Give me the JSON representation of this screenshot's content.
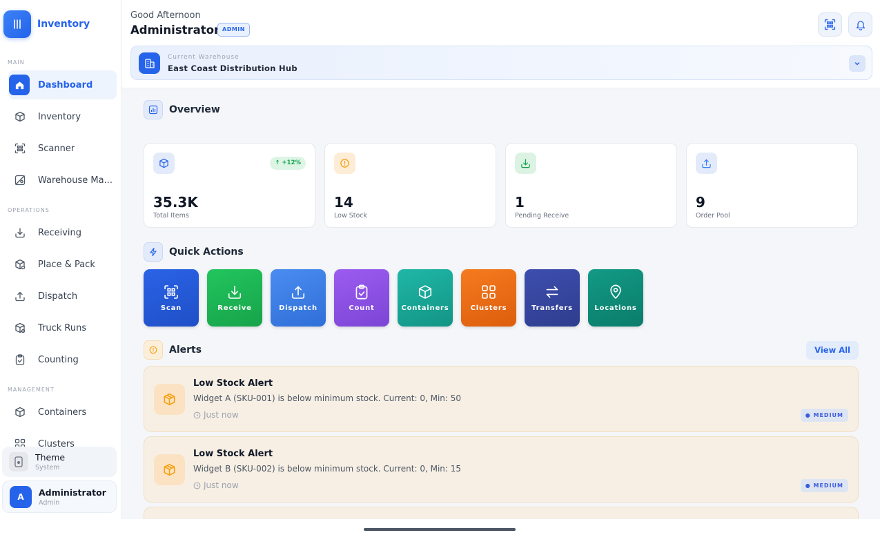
{
  "sidebar": {
    "brand": "Inventory",
    "sections": {
      "main": "MAIN",
      "operations": "OPERATIONS",
      "management": "MANAGEMENT"
    },
    "items": [
      {
        "label": "Dashboard",
        "icon": "home-icon"
      },
      {
        "label": "Inventory",
        "icon": "box-icon"
      },
      {
        "label": "Scanner",
        "icon": "scan-icon"
      },
      {
        "label": "Warehouse Ma...",
        "icon": "map-icon"
      },
      {
        "label": "Receiving",
        "icon": "download-icon"
      },
      {
        "label": "Place & Pack",
        "icon": "package-icon"
      },
      {
        "label": "Dispatch",
        "icon": "upload-icon"
      },
      {
        "label": "Truck Runs",
        "icon": "truck-box-icon"
      },
      {
        "label": "Counting",
        "icon": "clipboard-icon"
      },
      {
        "label": "Containers",
        "icon": "container-icon"
      },
      {
        "label": "Clusters",
        "icon": "grid-icon"
      }
    ],
    "theme": {
      "title": "Theme",
      "sub": "System"
    },
    "user": {
      "initial": "A",
      "name": "Administrator",
      "role": "Admin"
    }
  },
  "header": {
    "greeting": "Good Afternoon",
    "name": "Administrator",
    "badge": "ADMIN",
    "warehouse_label": "Current Warehouse",
    "warehouse_value": "East Coast Distribution Hub"
  },
  "overview": {
    "title": "Overview",
    "stats": [
      {
        "value": "35.3K",
        "label": "Total Items",
        "trend": "+12%"
      },
      {
        "value": "14",
        "label": "Low Stock"
      },
      {
        "value": "1",
        "label": "Pending Receive"
      },
      {
        "value": "9",
        "label": "Order Pool"
      }
    ]
  },
  "quick_actions": {
    "title": "Quick Actions",
    "items": [
      "Scan",
      "Receive",
      "Dispatch",
      "Count",
      "Containers",
      "Clusters",
      "Transfers",
      "Locations"
    ]
  },
  "alerts": {
    "title": "Alerts",
    "view_all": "View All",
    "items": [
      {
        "title": "Low Stock Alert",
        "message": "Widget A (SKU-001) is below minimum stock. Current: 0, Min: 50",
        "time": "Just now",
        "severity": "MEDIUM"
      },
      {
        "title": "Low Stock Alert",
        "message": "Widget B (SKU-002) is below minimum stock. Current: 0, Min: 15",
        "time": "Just now",
        "severity": "MEDIUM"
      }
    ]
  },
  "colors": {
    "accent": "#2563eb",
    "qa_scan": "#2456d6",
    "qa_receive": "#1fb457",
    "qa_dispatch": "#3b7be0",
    "qa_count": "#8b4fe0",
    "qa_containers": "#17a596",
    "qa_clusters": "#ea6a12",
    "qa_transfers": "#36459e",
    "qa_locations": "#0f8a78"
  }
}
